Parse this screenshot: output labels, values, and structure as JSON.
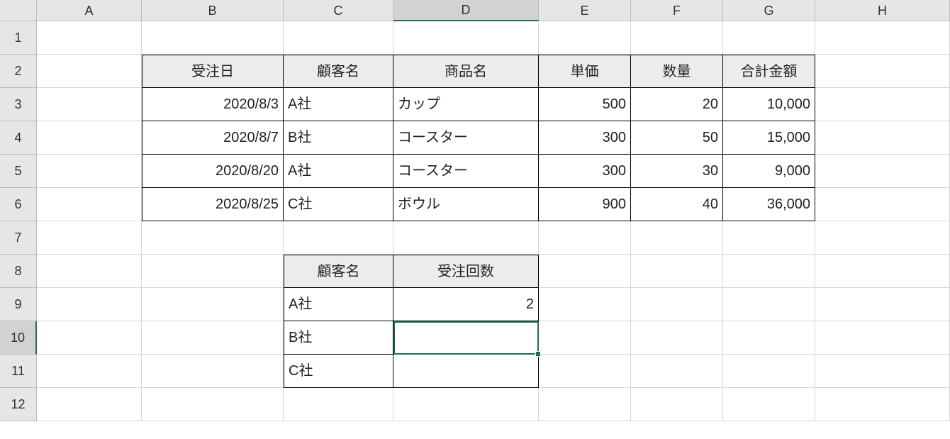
{
  "columns": [
    "A",
    "B",
    "C",
    "D",
    "E",
    "F",
    "G",
    "H"
  ],
  "rows": [
    "1",
    "2",
    "3",
    "4",
    "5",
    "6",
    "7",
    "8",
    "9",
    "10",
    "11",
    "12"
  ],
  "selected_col": "D",
  "selected_row": "10",
  "table1": {
    "headers": {
      "B": "受注日",
      "C": "顧客名",
      "D": "商品名",
      "E": "単価",
      "F": "数量",
      "G": "合計金額"
    },
    "rows": [
      {
        "B": "2020/8/3",
        "C": "A社",
        "D": "カップ",
        "E": "500",
        "F": "20",
        "G": "10,000"
      },
      {
        "B": "2020/8/7",
        "C": "B社",
        "D": "コースター",
        "E": "300",
        "F": "50",
        "G": "15,000"
      },
      {
        "B": "2020/8/20",
        "C": "A社",
        "D": "コースター",
        "E": "300",
        "F": "30",
        "G": "9,000"
      },
      {
        "B": "2020/8/25",
        "C": "C社",
        "D": "ボウル",
        "E": "900",
        "F": "40",
        "G": "36,000"
      }
    ]
  },
  "table2": {
    "headers": {
      "C": "顧客名",
      "D": "受注回数"
    },
    "rows": [
      {
        "C": "A社",
        "D": "2"
      },
      {
        "C": "B社",
        "D": ""
      },
      {
        "C": "C社",
        "D": ""
      }
    ]
  }
}
